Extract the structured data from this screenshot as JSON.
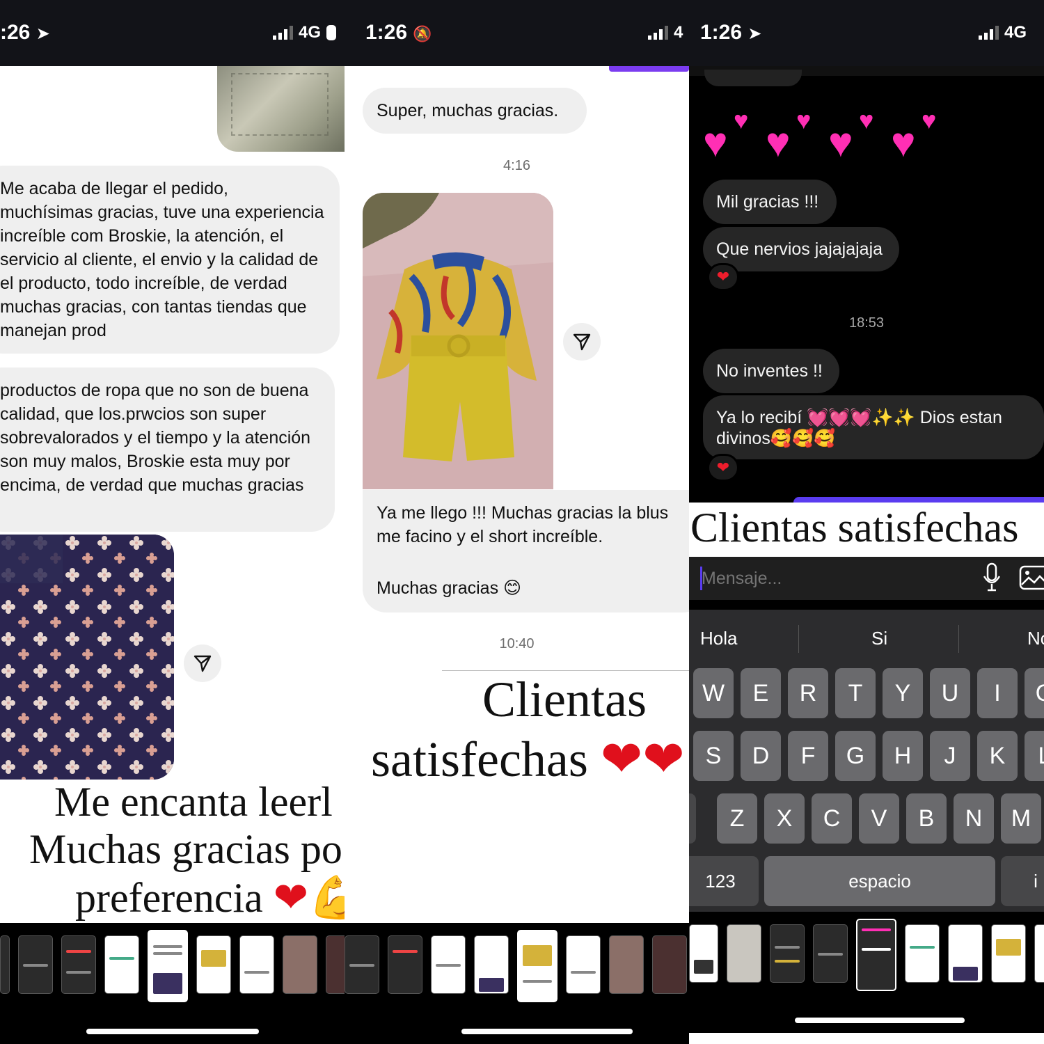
{
  "panel1": {
    "status": {
      "time": ":26",
      "network": "4G"
    },
    "messages": [
      "Me acaba de llegar el pedido, muchísimas gracias, tuve una experiencia increíble com Broskie, la atención, el servicio al cliente, el envio y la calidad de el producto, todo increíble, de verdad muchas gracias, con tantas tiendas que manejan prod",
      "productos de ropa que no son de buena calidad, que los.prwcios son super sobrevalorados y el tiempo y la atención son muy malos, Broskie esta muy por encima, de verdad que muchas gracias"
    ],
    "caption": {
      "line1": "Me encanta leerl",
      "line2": "Muchas gracias po",
      "line3": "preferencia"
    }
  },
  "panel2": {
    "status": {
      "time": "1:26",
      "network": "4"
    },
    "message_top": "Super, muchas gracias.",
    "timestamp1": "4:16",
    "reply": {
      "line1": "Ya me llego !!! Muchas gracias la blus",
      "line2": "me facino y el short increíble.",
      "line3": "Muchas gracias 😊"
    },
    "timestamp2": "10:40",
    "caption": {
      "line1": "Clientas",
      "line2": "satisfechas"
    }
  },
  "panel3": {
    "status": {
      "time": "1:26",
      "network": "4G"
    },
    "messages": {
      "m1": "Mil gracias !!!",
      "m2": "Que nervios jajajajaja",
      "m3": "No inventes !!",
      "m4a": "Ya lo recibí 💓💓💓✨✨ Dios estan",
      "m4b": "divinos🥰🥰🥰"
    },
    "timestamp": "18:53",
    "caption": "Clientas satisfechas",
    "input_placeholder": "Mensaje...",
    "suggestions": [
      "Hola",
      "Si",
      "No"
    ],
    "keyboard": {
      "row1": [
        "W",
        "E",
        "R",
        "T",
        "Y",
        "U",
        "I",
        "O"
      ],
      "row2": [
        "S",
        "D",
        "F",
        "G",
        "H",
        "J",
        "K",
        "L"
      ],
      "row3": [
        "Z",
        "X",
        "C",
        "V",
        "B",
        "N",
        "M"
      ],
      "numbers_key": "123",
      "space_key": "espacio",
      "return_key": "i"
    }
  },
  "colors": {
    "accent_heart": "#e0101c",
    "pink_heart": "#ff2fb4",
    "purple_accent": "#7b3cf0"
  }
}
